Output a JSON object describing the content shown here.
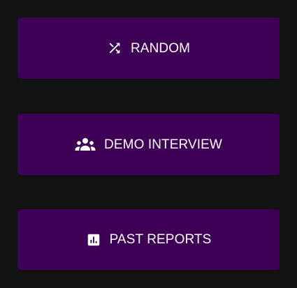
{
  "buttons": [
    {
      "label": "RANDOM",
      "icon": "shuffle-icon"
    },
    {
      "label": "DEMO INTERVIEW",
      "icon": "people-group-icon"
    },
    {
      "label": "PAST REPORTS",
      "icon": "bar-chart-report-icon"
    }
  ],
  "colors": {
    "background": "#121212",
    "button_fill": "#3d0055",
    "text": "#ffffff"
  }
}
